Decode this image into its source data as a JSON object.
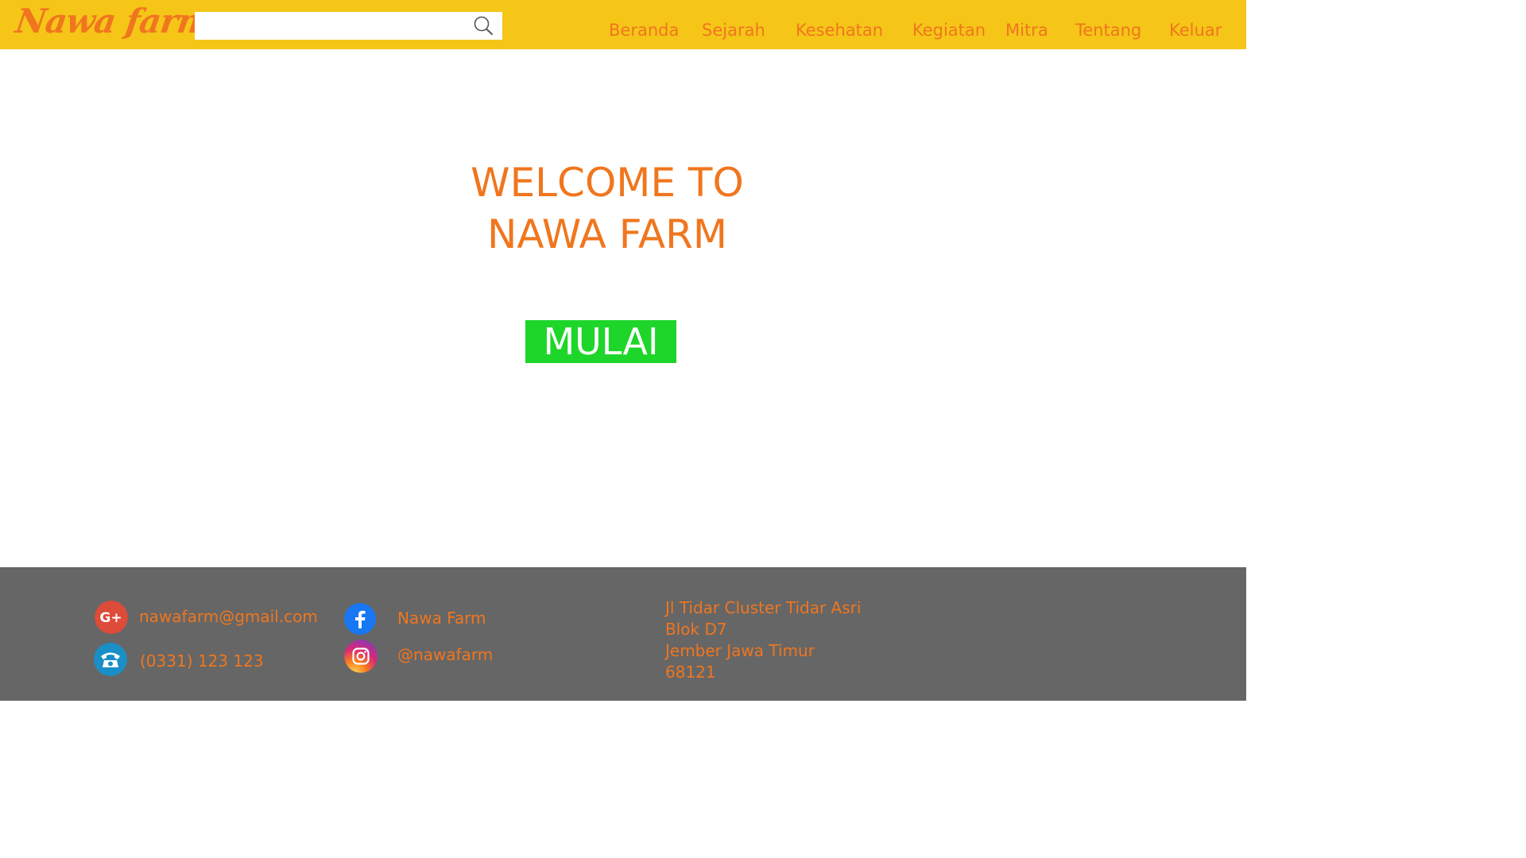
{
  "header": {
    "logo": "Nawa farm",
    "search": {
      "value": "",
      "placeholder": ""
    },
    "nav": [
      "Beranda",
      "Sejarah",
      "Kesehatan",
      "Kegiatan",
      "Mitra",
      "Tentang",
      "Keluar"
    ]
  },
  "hero": {
    "title_line1": "WELCOME TO",
    "title_line2": "NAWA FARM",
    "button": "MULAI"
  },
  "footer": {
    "email": "nawafarm@gmail.com",
    "phone": "(0331) 123 123",
    "facebook": "Nawa Farm",
    "instagram": "@nawafarm",
    "address": [
      "Jl Tidar Cluster Tidar Asri",
      "Blok D7",
      "Jember Jawa Timur",
      "68121"
    ]
  },
  "colors": {
    "header_bg": "#f5c518",
    "accent": "#f0761e",
    "button_bg": "#1ed62a",
    "footer_bg": "#666666"
  },
  "icons": [
    "search-icon",
    "google-plus-icon",
    "phone-icon",
    "facebook-icon",
    "instagram-icon"
  ]
}
